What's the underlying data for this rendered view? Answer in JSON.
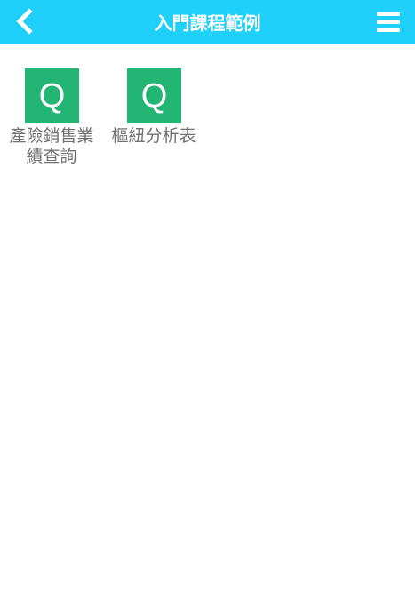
{
  "header": {
    "title": "入門課程範例",
    "background_color": "#1fd0fa",
    "back_icon": "chevron-left-icon",
    "menu_icon": "hamburger-menu-icon"
  },
  "apps": [
    {
      "label": "產險銷售業績查詢",
      "icon": "q-app-icon",
      "icon_letter": "Q",
      "icon_color": "#22b574"
    },
    {
      "label": "樞紐分析表",
      "icon": "q-app-icon",
      "icon_letter": "Q",
      "icon_color": "#22b574"
    }
  ]
}
